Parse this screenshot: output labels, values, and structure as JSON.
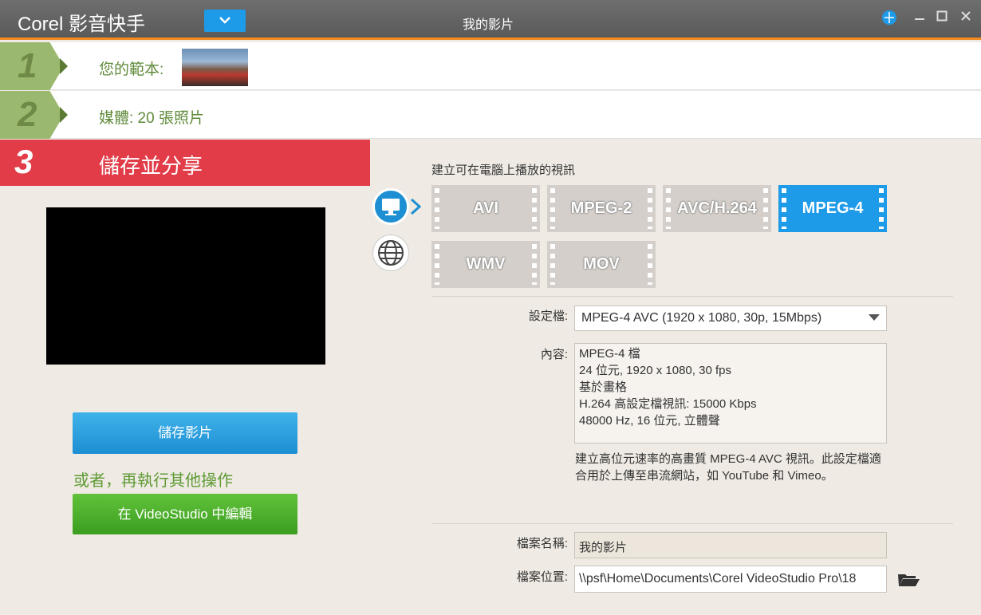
{
  "titlebar": {
    "app_title": "Corel 影音快手",
    "window_title": "我的影片"
  },
  "steps": {
    "step1": {
      "number": "1",
      "label": "您的範本:"
    },
    "step2": {
      "number": "2",
      "label": "媒體:   20 張照片"
    },
    "step3": {
      "number": "3",
      "label": "儲存並分享"
    }
  },
  "left": {
    "save_button": "儲存影片",
    "or_text": "或者，再執行其他操作",
    "edit_button": "在 VideoStudio 中編輯"
  },
  "right": {
    "heading": "建立可在電腦上播放的視訊",
    "formats": [
      "AVI",
      "MPEG-2",
      "AVC/H.264",
      "MPEG-4",
      "WMV",
      "MOV"
    ],
    "selected_format": "MPEG-4",
    "profile_label": "設定檔:",
    "profile_value": "MPEG-4 AVC (1920 x 1080, 30p, 15Mbps)",
    "content_label": "內容:",
    "content_lines": [
      "MPEG-4 檔",
      "24 位元, 1920 x 1080, 30 fps",
      "基於畫格",
      "H.264 高設定檔視訊: 15000 Kbps",
      "48000 Hz, 16 位元, 立體聲"
    ],
    "description": "建立高位元速率的高畫質 MPEG-4 AVC 視訊。此設定檔適合用於上傳至串流網站，如 YouTube 和 Vimeo。",
    "filename_label": "檔案名稱:",
    "filename_value": "我的影片",
    "location_label": "檔案位置:",
    "location_value": "\\\\psf\\Home\\Documents\\Corel VideoStudio Pro\\18"
  },
  "colors": {
    "accent_orange": "#f28a1e",
    "step_green": "#9bb86f",
    "step3_red": "#e13c48",
    "selected_blue": "#1e9be8",
    "edit_green": "#4caf2a"
  }
}
